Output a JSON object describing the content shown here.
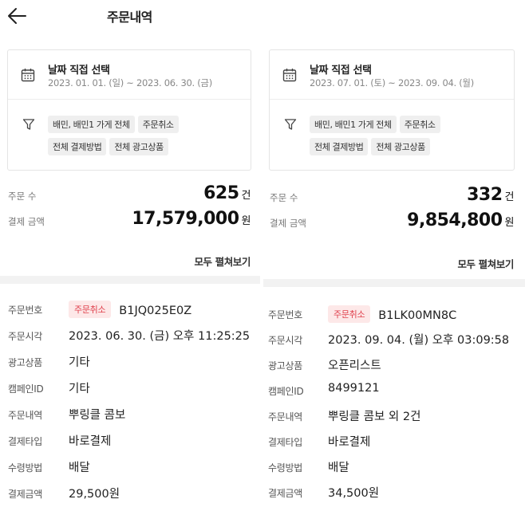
{
  "header": {
    "title": "주문내역"
  },
  "panels": [
    {
      "date_title": "날짜 직접 선택",
      "date_range": "2023. 01. 01. (일) ~ 2023. 06. 30. (금)",
      "chips": [
        "배민, 배민1 가게 전체",
        "주문취소",
        "전체 결제방법",
        "전체 광고상품"
      ],
      "order_count_label": "주문 수",
      "order_count": "625",
      "order_count_unit": "건",
      "amount_label": "결제 금액",
      "amount": "17,579,000",
      "amount_unit": "원",
      "expand_all": "모두 펼쳐보기",
      "detail": {
        "order_no_label": "주문번호",
        "status_badge": "주문취소",
        "order_no": "B1JQ025E0Z",
        "time_label": "주문시각",
        "time": "2023. 06. 30. (금) 오후 11:25:25",
        "ad_label": "광고상품",
        "ad": "기타",
        "campaign_label": "캠페인ID",
        "campaign": "기타",
        "items_label": "주문내역",
        "items": "뿌링클 콤보",
        "pay_type_label": "결제타입",
        "pay_type": "바로결제",
        "receive_label": "수령방법",
        "receive": "배달",
        "amount_label": "결제금액",
        "amount": "29,500원"
      }
    },
    {
      "date_title": "날짜 직접 선택",
      "date_range": "2023. 07. 01. (토) ~ 2023. 09. 04. (월)",
      "chips": [
        "배민, 배민1 가게 전체",
        "주문취소",
        "전체 결제방법",
        "전체 광고상품"
      ],
      "order_count_label": "주문 수",
      "order_count": "332",
      "order_count_unit": "건",
      "amount_label": "결제 금액",
      "amount": "9,854,800",
      "amount_unit": "원",
      "expand_all": "모두 펼쳐보기",
      "detail": {
        "order_no_label": "주문번호",
        "status_badge": "주문취소",
        "order_no": "B1LK00MN8C",
        "time_label": "주문시각",
        "time": "2023. 09. 04. (월) 오후 03:09:58",
        "ad_label": "광고상품",
        "ad": "오픈리스트",
        "campaign_label": "캠페인ID",
        "campaign": "8499121",
        "items_label": "주문내역",
        "items": "뿌링클 콤보 외 2건",
        "pay_type_label": "결제타입",
        "pay_type": "바로결제",
        "receive_label": "수령방법",
        "receive": "배달",
        "amount_label": "결제금액",
        "amount": "34,500원"
      }
    }
  ],
  "icons": {
    "back": "back-arrow-icon",
    "calendar": "calendar-icon",
    "filter": "filter-icon"
  },
  "colors": {
    "badge_bg": "#fde8e8",
    "badge_text": "#e0424e",
    "divider": "#f2f2f2"
  }
}
